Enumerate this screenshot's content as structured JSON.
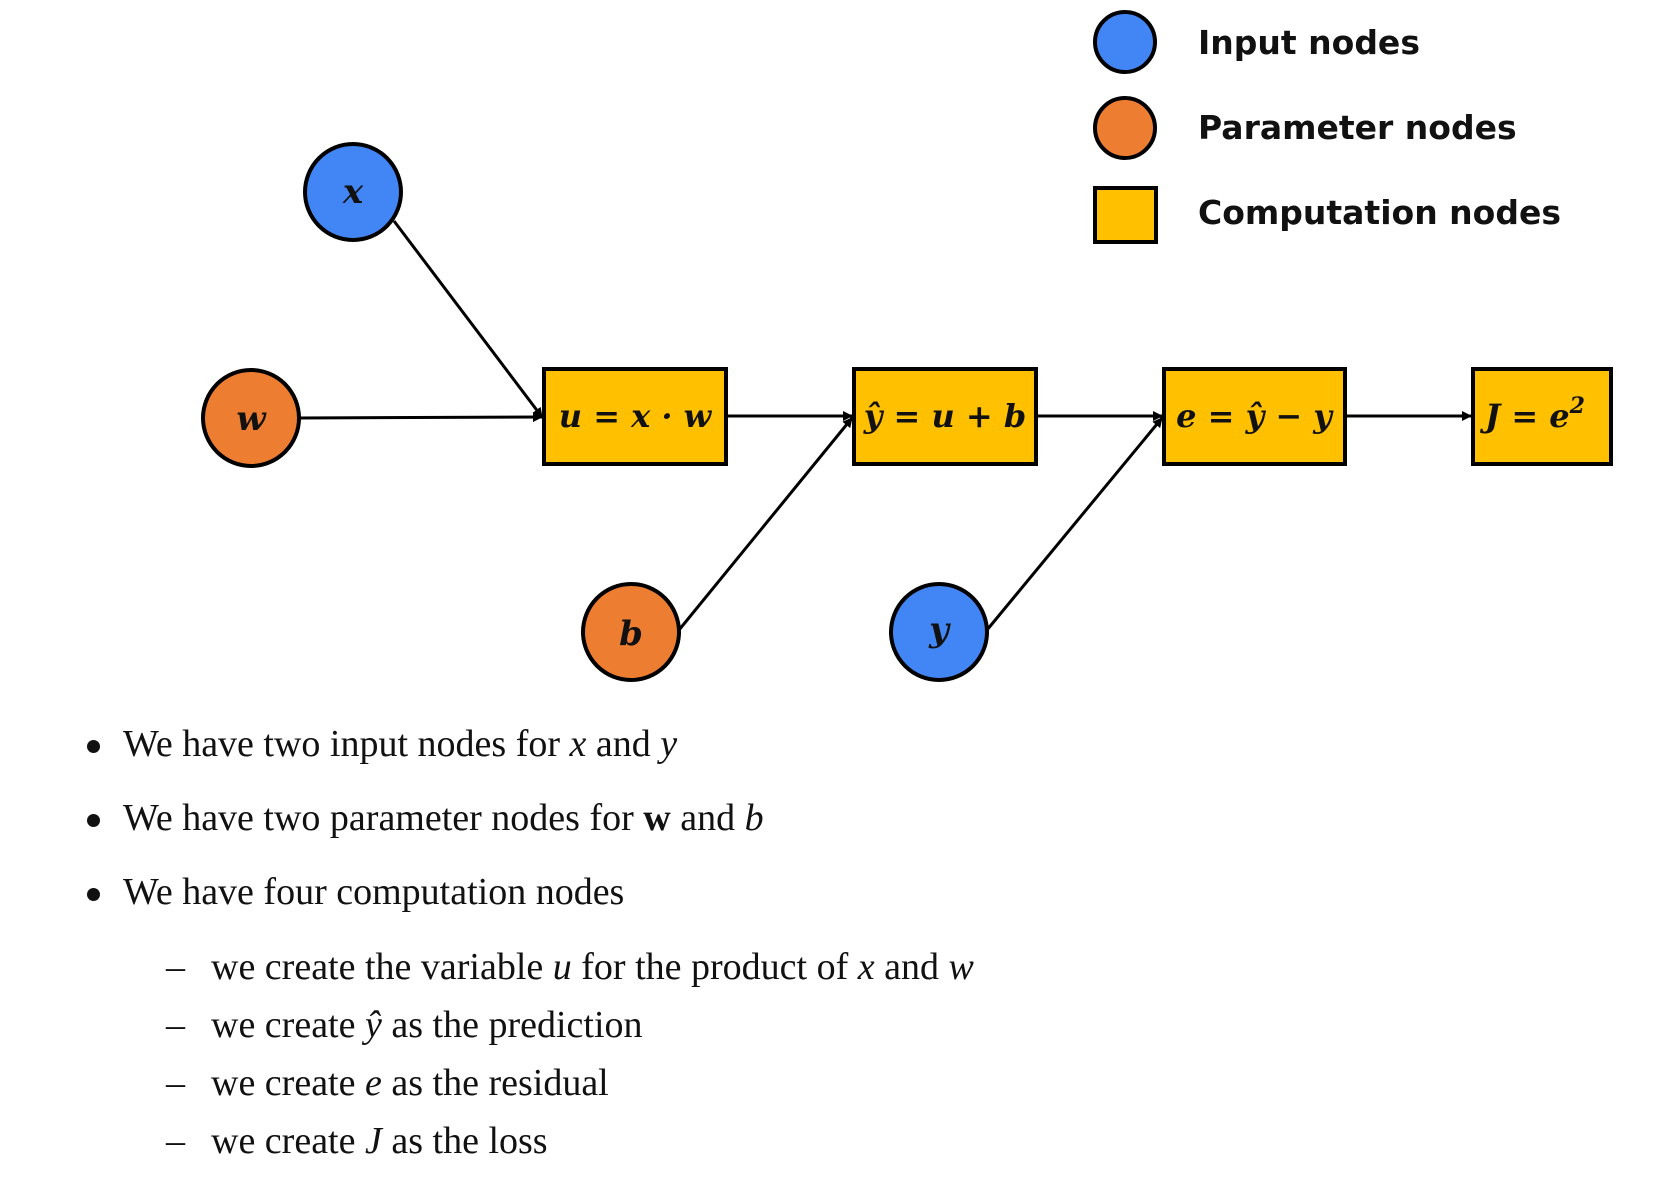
{
  "colors": {
    "input": "#4285f4",
    "parameter": "#ed7d31",
    "computation": "#ffc000",
    "stroke": "#000000"
  },
  "legend": [
    {
      "shape": "circle",
      "color": "input",
      "label": "Input nodes"
    },
    {
      "shape": "circle",
      "color": "parameter",
      "label": "Parameter nodes"
    },
    {
      "shape": "square",
      "color": "computation",
      "label": "Computation nodes"
    }
  ],
  "nodes": {
    "x": {
      "type": "input",
      "label": "x"
    },
    "w": {
      "type": "parameter",
      "label": "w"
    },
    "b": {
      "type": "parameter",
      "label": "b"
    },
    "y": {
      "type": "input",
      "label": "y"
    },
    "u": {
      "type": "computation",
      "label": "u = x · w"
    },
    "yhat": {
      "type": "computation",
      "label": "ŷ = u + b"
    },
    "e": {
      "type": "computation",
      "label": "e = ŷ − y"
    },
    "J": {
      "type": "computation",
      "label": "J = e",
      "sup": "2"
    }
  },
  "edges": [
    [
      "x",
      "u"
    ],
    [
      "w",
      "u"
    ],
    [
      "u",
      "yhat"
    ],
    [
      "b",
      "yhat"
    ],
    [
      "yhat",
      "e"
    ],
    [
      "y",
      "e"
    ],
    [
      "e",
      "J"
    ]
  ],
  "bullets": [
    {
      "pre": "We have two input nodes for ",
      "v1": "x",
      "mid": " and ",
      "v2": "y"
    },
    {
      "pre": "We have two parameter nodes for ",
      "v1": "w",
      "mid": " and ",
      "v2": "b"
    },
    {
      "pre": "We have four computation nodes"
    }
  ],
  "subitems": [
    {
      "pre": "we create the variable ",
      "v1": "u",
      "mid": " for the product of ",
      "v2": "x",
      "mid2": " and ",
      "v3": "w"
    },
    {
      "pre": "we create ",
      "v1": "ŷ",
      "post": " as the prediction"
    },
    {
      "pre": "we create ",
      "v1": "e",
      "post": " as the residual"
    },
    {
      "pre": "we create ",
      "v1": "J",
      "post": " as the loss"
    }
  ],
  "dash": "–"
}
